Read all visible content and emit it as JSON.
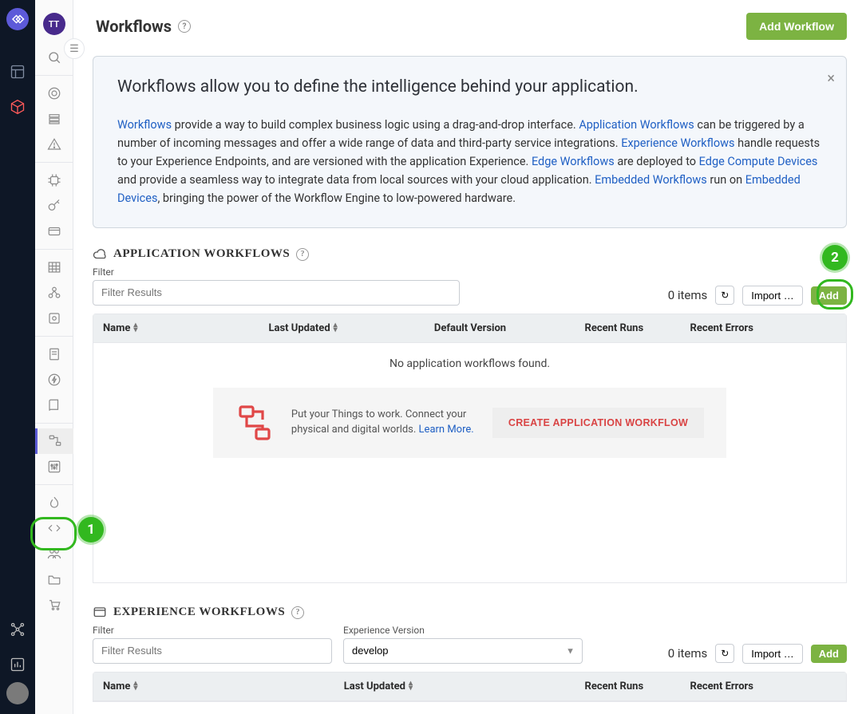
{
  "primaryNav": {
    "logoAlt": "logo"
  },
  "secondaryNav": {
    "avatar": "TT"
  },
  "header": {
    "title": "Workflows",
    "addBtn": "Add Workflow"
  },
  "banner": {
    "heading": "Workflows allow you to define the intelligence behind your application.",
    "link1": "Workflows",
    "text1": " provide a way to build complex business logic using a drag-and-drop interface. ",
    "link2": "Application Workflows",
    "text2": " can be triggered by a number of incoming messages and offer a wide range of data and third-party service integrations. ",
    "link3": "Experience Workflows",
    "text3": " handle requests to your Experience Endpoints, and are versioned with the application Experience. ",
    "link4": "Edge Workflows",
    "text4": " are deployed to ",
    "link5": "Edge Compute Devices",
    "text5": " and provide a seamless way to integrate data from local sources with your cloud application. ",
    "link6": "Embedded Workflows",
    "text6": " run on ",
    "link7": "Embedded Devices",
    "text7": ", bringing the power of the Workflow Engine to low-powered hardware."
  },
  "appSection": {
    "title": "APPLICATION WORKFLOWS",
    "filterLabel": "Filter",
    "filterPlaceholder": "Filter Results",
    "itemsCount": "0 items",
    "importBtn": "Import …",
    "addBtn": "Add",
    "columns": {
      "name": "Name",
      "lastUpdated": "Last Updated",
      "defaultVersion": "Default Version",
      "recentRuns": "Recent Runs",
      "recentErrors": "Recent Errors"
    },
    "emptyMsg": "No application workflows found.",
    "cta": {
      "text": "Put your Things to work. Connect your physical and digital worlds. ",
      "learnMore": "Learn More.",
      "btn": "CREATE APPLICATION WORKFLOW"
    }
  },
  "expSection": {
    "title": "EXPERIENCE WORKFLOWS",
    "filterLabel": "Filter",
    "filterPlaceholder": "Filter Results",
    "versionLabel": "Experience Version",
    "versionValue": "develop",
    "itemsCount": "0 items",
    "importBtn": "Import …",
    "addBtn": "Add",
    "columns": {
      "name": "Name",
      "lastUpdated": "Last Updated",
      "recentRuns": "Recent Runs",
      "recentErrors": "Recent Errors"
    }
  },
  "callouts": {
    "c1": "1",
    "c2": "2"
  }
}
